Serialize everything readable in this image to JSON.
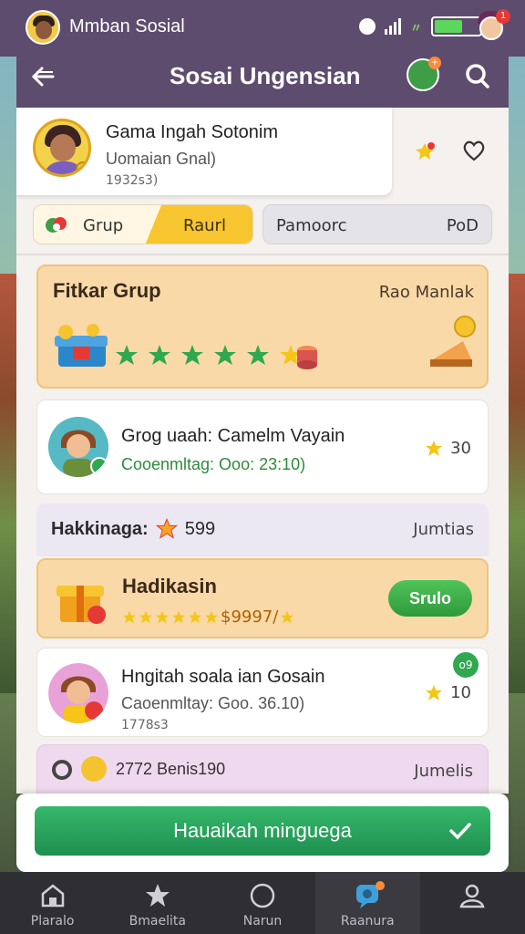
{
  "status_bar": {
    "title": "Mmban Sosial",
    "notification_count": "1"
  },
  "header": {
    "title": "Sosai Ungensian"
  },
  "profile": {
    "name": "Gama Ingah Sotonim",
    "subtitle": "Uomaian Gnal)",
    "code": "1932s3)"
  },
  "tabs": {
    "group_label": "Grup",
    "active_label": "Raurl",
    "alt_left": "Pamoorc",
    "alt_right": "PoD"
  },
  "featured": {
    "title": "Fitkar Grup",
    "side_label": "Rao Manlak",
    "stars": 6
  },
  "items": [
    {
      "title": "Grog uaah: Camelm Vayain",
      "subtitle": "Cooenmltag: Ooo: 23:10)",
      "rating": "30"
    },
    {
      "title": "Hngitah soala ian Gosain",
      "subtitle": "Caoenmltay: Goo. 36.10)",
      "code": "1778s3",
      "rating": "10",
      "badge": "o9"
    }
  ],
  "section": {
    "title": "Hakkinaga:",
    "value": "599",
    "right_label": "Jumtias"
  },
  "reward": {
    "title": "Hadikasin",
    "value": "$9997/",
    "button": "Srulo"
  },
  "bottom_strip": {
    "text": "2772 Benis190",
    "right_label": "Jumelis"
  },
  "action": {
    "label": "Hauaikah minguega"
  },
  "nav": [
    {
      "label": "Plaralo"
    },
    {
      "label": "Bmaelita"
    },
    {
      "label": "Narun"
    },
    {
      "label": "Raanura"
    },
    {
      "label": ""
    }
  ],
  "colors": {
    "header_purple": "#5e4c6f",
    "accent_yellow": "#f7c530",
    "card_orange": "#f9d9a8",
    "green_button": "#2e9a3b"
  }
}
